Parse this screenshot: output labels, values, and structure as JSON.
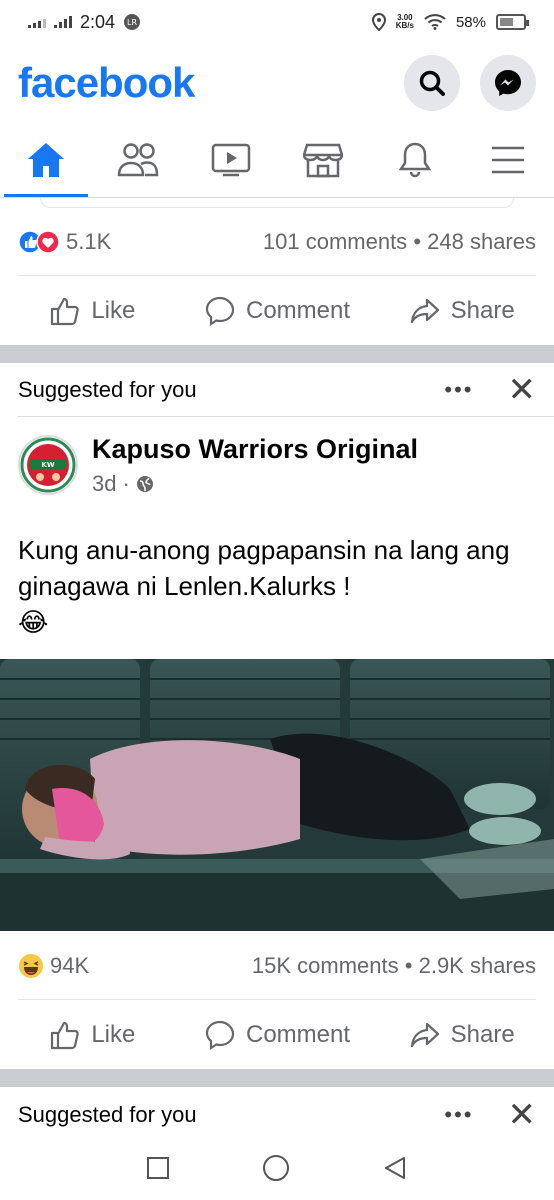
{
  "status": {
    "time": "2:04",
    "netspeed_top": "3.00",
    "netspeed_bottom": "KB/s",
    "battery": "58%",
    "battery_level": 0.58
  },
  "header": {
    "logo": "facebook",
    "search_icon": "search-icon",
    "messenger_icon": "messenger-icon"
  },
  "nav": {
    "tabs": [
      "home",
      "friends",
      "watch",
      "marketplace",
      "notifications",
      "menu"
    ],
    "active": "home",
    "accent": "#1877f2"
  },
  "post1": {
    "reactions_count": "5.1K",
    "comments": "101 comments",
    "shares": "248 shares",
    "dot": "•"
  },
  "actions": {
    "like": "Like",
    "comment": "Comment",
    "share": "Share"
  },
  "suggested": {
    "label": "Suggested for you",
    "more": "•••",
    "close": "✕"
  },
  "post2": {
    "page_name": "Kapuso Warriors Original",
    "age": "3d",
    "meta_dot": "·",
    "text": "Kung anu-anong pagpapansin na lang ang ginagawa ni Lenlen.Kalurks !",
    "emoji": "😂",
    "reactions_count": "94K",
    "comments": "15K comments",
    "shares": "2.9K shares",
    "dot": "•"
  },
  "suggested2": {
    "label": "Suggested for you",
    "more": "•••",
    "close": "✕"
  }
}
